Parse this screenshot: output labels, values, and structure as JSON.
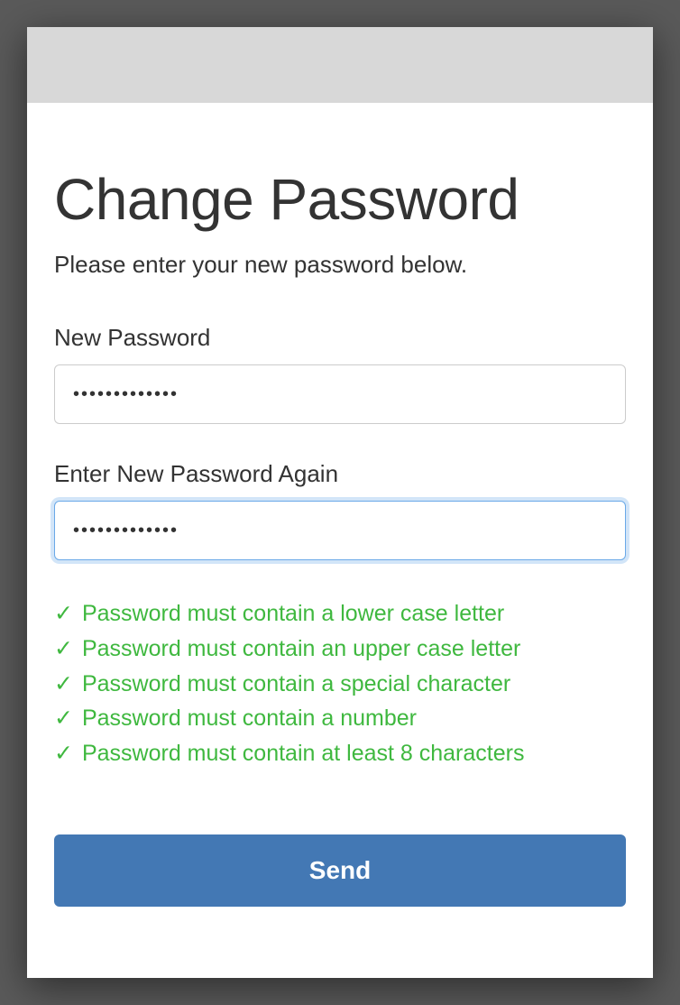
{
  "title": "Change Password",
  "subtitle": "Please enter your new password below.",
  "fields": {
    "new_password": {
      "label": "New Password",
      "value": "•••••••••••••"
    },
    "confirm_password": {
      "label": "Enter New Password Again",
      "value": "•••••••••••••"
    }
  },
  "requirements": [
    {
      "text": "Password must contain a lower case letter",
      "met": true
    },
    {
      "text": "Password must contain an upper case letter",
      "met": true
    },
    {
      "text": "Password must contain a special character",
      "met": true
    },
    {
      "text": "Password must contain a number",
      "met": true
    },
    {
      "text": "Password must contain at least 8 characters",
      "met": true
    }
  ],
  "submit_label": "Send"
}
